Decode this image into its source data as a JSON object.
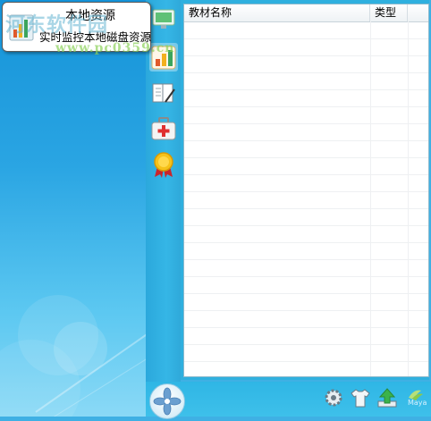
{
  "tooltip": {
    "title": "本地资源",
    "description": "实时监控本地磁盘资源"
  },
  "watermark": {
    "line1": "河东软件园",
    "line2": "www.pc0359.cn"
  },
  "toolbar": {
    "items": [
      {
        "icon": "monitor-icon"
      },
      {
        "icon": "bar-chart-icon"
      },
      {
        "icon": "notebook-icon"
      },
      {
        "icon": "first-aid-kit-icon"
      },
      {
        "icon": "award-medal-icon"
      }
    ],
    "active_index": 1
  },
  "table": {
    "columns": [
      "教材名称",
      "类型"
    ],
    "rows": []
  },
  "bottombar": {
    "home_icon": "flower-logo-icon",
    "icons": [
      "settings-gear-icon",
      "skin-shirt-icon",
      "upload-arrow-icon",
      "maya-logo-icon"
    ],
    "logo_text": "Maya"
  },
  "colors": {
    "accent": "#2fb0df",
    "wallpaper_top": "#1593d8",
    "wallpaper_bottom": "#8ad9f6"
  }
}
